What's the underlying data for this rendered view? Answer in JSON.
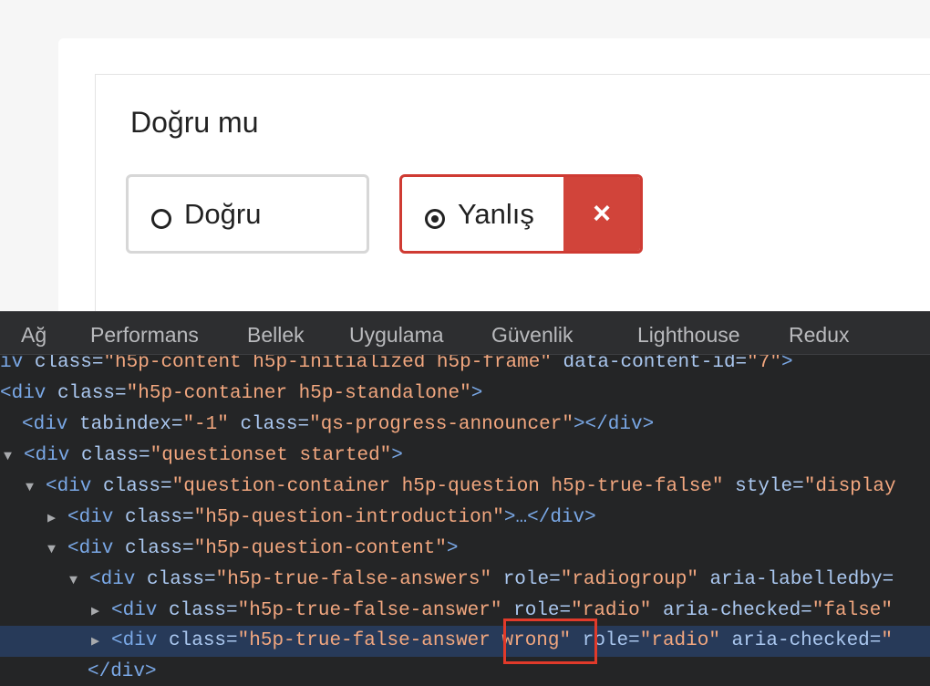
{
  "quiz": {
    "question": "Doğru mu",
    "answers": [
      {
        "label": "Doğru"
      },
      {
        "label": "Yanlış",
        "wrong_icon": "×"
      }
    ]
  },
  "devtools": {
    "tabs": [
      "Ağ",
      "Performans",
      "Bellek",
      "Uygulama",
      "Güvenlik",
      "Lighthouse",
      "Redux"
    ],
    "dom": {
      "line0": {
        "tag": "iv",
        "a1": " class=",
        "v1": "\"h5p-content h5p-initialized h5p-frame\"",
        "a2": " data-content-id=",
        "v2": "\"7\"",
        "end": ">"
      },
      "line1": {
        "open": "<div",
        "a1": " class=",
        "v1": "\"h5p-container h5p-standalone\"",
        "end": ">"
      },
      "line2": {
        "open": "<div",
        "a1": " tabindex=",
        "v1": "\"-1\"",
        "a2": " class=",
        "v2": "\"qs-progress-announcer\"",
        "end": "></div>"
      },
      "line3": {
        "open": "<div",
        "a1": " class=",
        "v1": "\"questionset started\"",
        "end": ">"
      },
      "line4": {
        "open": "<div",
        "a1": " class=",
        "v1": "\"question-container h5p-question h5p-true-false\"",
        "a2": " style=",
        "v2": "\"display"
      },
      "line5": {
        "open": "<div",
        "a1": " class=",
        "v1": "\"h5p-question-introduction\"",
        "end": ">…</div>"
      },
      "line6": {
        "open": "<div",
        "a1": " class=",
        "v1": "\"h5p-question-content\"",
        "end": ">"
      },
      "line7": {
        "open": "<div",
        "a1": " class=",
        "v1": "\"h5p-true-false-answers\"",
        "a2": " role=",
        "v2": "\"radiogroup\"",
        "a3": " aria-labelledby="
      },
      "line8": {
        "open": "<div",
        "a1": " class=",
        "v1": "\"h5p-true-false-answer\"",
        "a2": " role=",
        "v2": "\"radio\"",
        "a3": " aria-checked=",
        "v3": "\"false\""
      },
      "line9": {
        "open": "<div",
        "a1": " class=",
        "v1": "\"h5p-true-false-answer wrong\"",
        "a2": " role=",
        "v2": "\"radio\"",
        "a3": " aria-checked=",
        "v3": "\""
      },
      "line10": {
        "close": "</div>"
      }
    }
  }
}
